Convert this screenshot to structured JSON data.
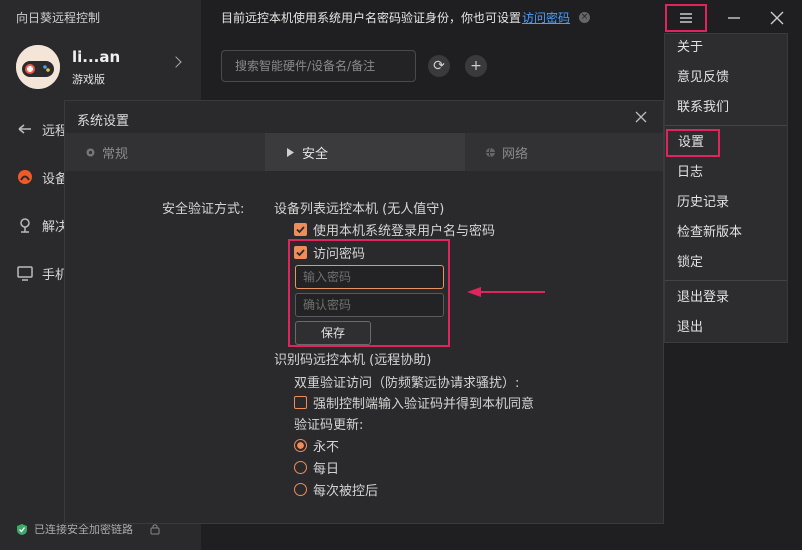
{
  "app": {
    "title": "向日葵远程控制"
  },
  "user": {
    "name": "li...an",
    "edition": "游戏版"
  },
  "sidebar": {
    "items": [
      {
        "label": "远程"
      },
      {
        "label": "设备"
      },
      {
        "label": "解决"
      },
      {
        "label": "手机"
      }
    ],
    "status": "已连接安全加密链路"
  },
  "notice": {
    "text": "目前远控本机使用系统用户名密码验证身份，你也可设置",
    "link": "访问密码"
  },
  "search": {
    "placeholder": "搜索智能硬件/设备名/备注"
  },
  "dialog": {
    "title": "系统设置",
    "tabs": [
      {
        "label": "常规"
      },
      {
        "label": "安全"
      },
      {
        "label": "网络"
      }
    ],
    "security_label": "安全验证方式:",
    "section1_title": "设备列表远控本机 (无人值守)",
    "opt_system_login": "使用本机系统登录用户名与密码",
    "opt_access_password": "访问密码",
    "input_password_placeholder": "输入密码",
    "input_confirm_placeholder": "确认密码",
    "save_label": "保存",
    "section2_title": "识别码远控本机 (远程协助)",
    "dual_verify": "双重验证访问（防频繁远协请求骚扰）:",
    "opt_force_code": "强制控制端输入验证码并得到本机同意",
    "code_update_label": "验证码更新:",
    "radios": [
      {
        "label": "永不"
      },
      {
        "label": "每日"
      },
      {
        "label": "每次被控后"
      }
    ]
  },
  "menu": {
    "items": [
      {
        "label": "关于"
      },
      {
        "label": "意见反馈"
      },
      {
        "label": "联系我们"
      },
      {
        "label": "设置"
      },
      {
        "label": "日志"
      },
      {
        "label": "历史记录"
      },
      {
        "label": "检查新版本"
      },
      {
        "label": "锁定"
      },
      {
        "label": "退出登录"
      },
      {
        "label": "退出"
      }
    ]
  },
  "colors": {
    "accent": "#f08c5a",
    "highlight": "#e0245e",
    "link": "#4a9eff",
    "arrow": "#e0245e"
  }
}
